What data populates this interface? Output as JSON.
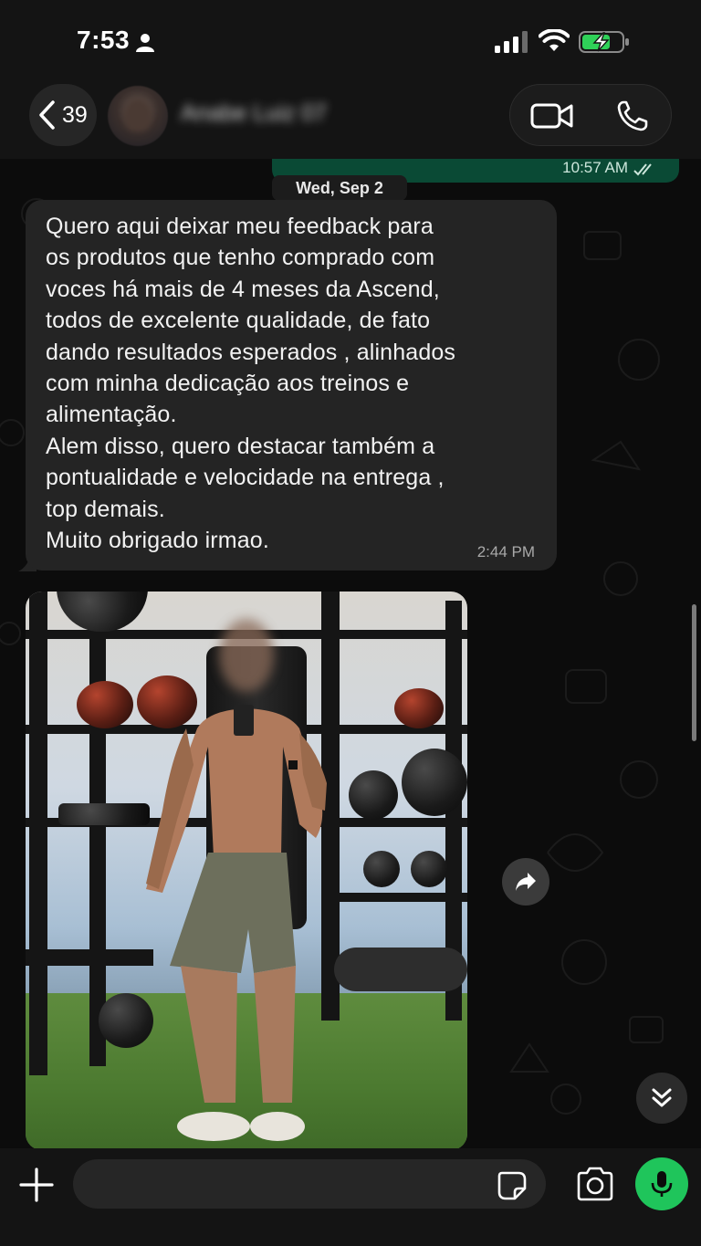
{
  "status_bar": {
    "time": "7:53",
    "icons": [
      "person-icon",
      "signal-icon",
      "wifi-icon",
      "battery-charging-icon"
    ]
  },
  "header": {
    "back_count": "39",
    "contact_name": "Anabe Luiz 07",
    "icons": [
      "chevron-left-icon",
      "video-call-icon",
      "phone-icon"
    ]
  },
  "chat": {
    "previous_message_time": "10:57 AM",
    "date_separator": "Wed, Sep 2",
    "message": {
      "text": "Quero aqui deixar meu feedback para\nos produtos que tenho comprado com\nvoces há mais de 4 meses da Ascend,\ntodos de excelente qualidade, de fato\ndando resultados esperados , alinhados\ncom minha dedicação aos treinos e\nalimentação.\nAlem disso, quero destacar também a\npontualidade e velocidade na entrega ,\ntop demais.\nMuito obrigado irmao.",
      "time": "2:44 PM"
    },
    "photo_icon": "gym-photo",
    "forward_icon": "forward-arrow-icon",
    "scroll_icon": "double-chevron-down-icon"
  },
  "input_bar": {
    "placeholder": "",
    "icons": [
      "plus-icon",
      "sticker-icon",
      "camera-icon",
      "microphone-icon"
    ],
    "mic_color": "#1fc55b"
  },
  "colors": {
    "background": "#0b0b0b",
    "incoming_bubble": "#242424",
    "outgoing_bubble": "#0a4a35",
    "accent_green": "#1fc55b"
  }
}
